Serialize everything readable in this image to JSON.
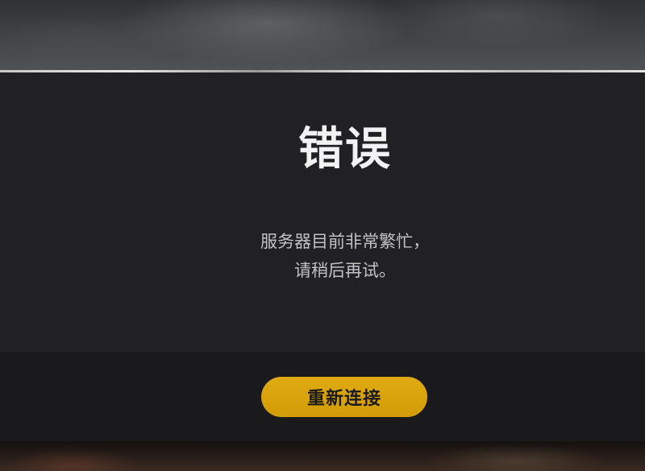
{
  "dialog": {
    "title": "错误",
    "message_line1": "服务器目前非常繁忙，",
    "message_line2": "请稍后再试。"
  },
  "footer": {
    "reconnect_label": "重新连接"
  },
  "colors": {
    "accent": "#d9a40c",
    "dialog_bg": "#212124",
    "footer_bg": "#1a1a1c",
    "title_text": "#f2f2f2",
    "message_text": "#c2c2c2"
  }
}
